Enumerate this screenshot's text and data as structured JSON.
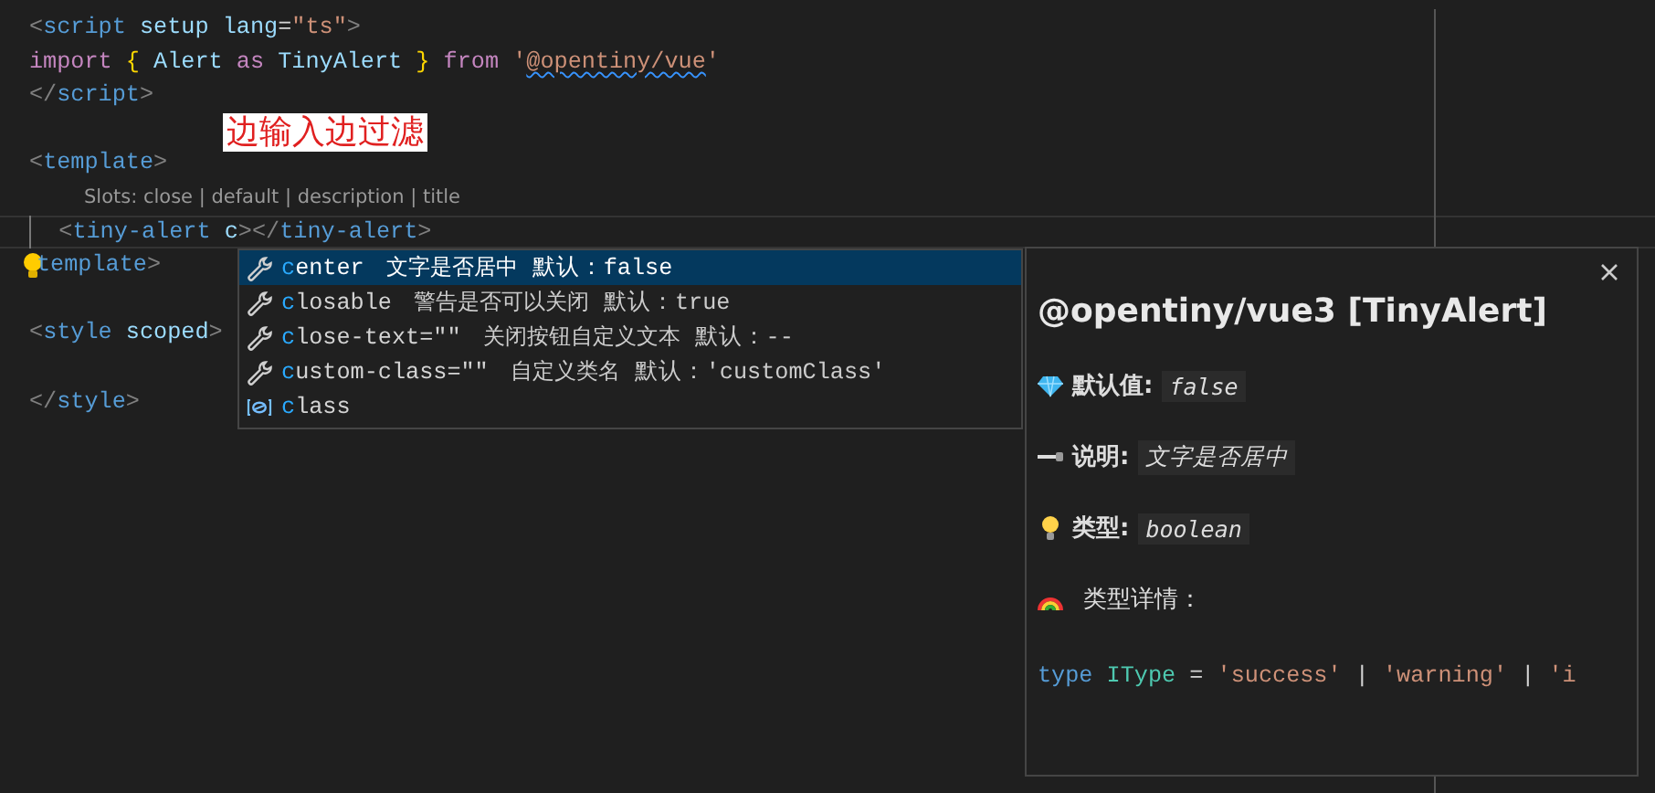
{
  "editor": {
    "lines": [
      {
        "kind": "code",
        "current": false,
        "lightbulb": false,
        "tokens": [
          {
            "text": "<",
            "kind": "bracket"
          },
          {
            "text": "script",
            "kind": "tag"
          },
          {
            "text": " setup",
            "kind": "attr"
          },
          {
            "text": " lang",
            "kind": "attr"
          },
          {
            "text": "=",
            "kind": "plain"
          },
          {
            "text": "\"ts\"",
            "kind": "string"
          },
          {
            "text": ">",
            "kind": "bracket"
          }
        ]
      },
      {
        "kind": "code",
        "current": false,
        "lightbulb": false,
        "tokens": [
          {
            "text": "import",
            "kind": "keyword"
          },
          {
            "text": " {",
            "kind": "brace"
          },
          {
            "text": " Alert",
            "kind": "variable"
          },
          {
            "text": " as",
            "kind": "keyword"
          },
          {
            "text": " TinyAlert",
            "kind": "variable"
          },
          {
            "text": " }",
            "kind": "brace"
          },
          {
            "text": " from",
            "kind": "keyword"
          },
          {
            "text": " '",
            "kind": "string"
          },
          {
            "text": "@opentiny/vue",
            "kind": "string",
            "squiggly": true
          },
          {
            "text": "'",
            "kind": "string"
          }
        ]
      },
      {
        "kind": "code",
        "current": false,
        "lightbulb": false,
        "tokens": [
          {
            "text": "</",
            "kind": "bracket"
          },
          {
            "text": "script",
            "kind": "tag"
          },
          {
            "text": ">",
            "kind": "bracket"
          }
        ]
      },
      {
        "kind": "blank"
      },
      {
        "kind": "code",
        "current": false,
        "lightbulb": false,
        "tokens": [
          {
            "text": "<",
            "kind": "bracket"
          },
          {
            "text": "template",
            "kind": "tag"
          },
          {
            "text": ">",
            "kind": "bracket"
          }
        ]
      },
      {
        "kind": "codelens",
        "text": "Slots: close | default | description | title"
      },
      {
        "kind": "code",
        "current": true,
        "lightbulb": false,
        "tokens": [
          {
            "text": "  <",
            "kind": "bracket"
          },
          {
            "text": "tiny-alert",
            "kind": "tag"
          },
          {
            "text": " c",
            "kind": "attr"
          },
          {
            "text": "></",
            "kind": "bracket"
          },
          {
            "text": "tiny-alert",
            "kind": "tag"
          },
          {
            "text": ">",
            "kind": "bracket"
          }
        ]
      },
      {
        "kind": "code",
        "current": false,
        "lightbulb": true,
        "tokens": [
          {
            "text": "template",
            "kind": "tag"
          },
          {
            "text": ">",
            "kind": "bracket"
          }
        ]
      },
      {
        "kind": "blank"
      },
      {
        "kind": "code",
        "current": false,
        "lightbulb": false,
        "tokens": [
          {
            "text": "<",
            "kind": "bracket"
          },
          {
            "text": "style",
            "kind": "tag"
          },
          {
            "text": " scoped",
            "kind": "attr"
          },
          {
            "text": ">",
            "kind": "bracket"
          }
        ]
      },
      {
        "kind": "blank"
      },
      {
        "kind": "code",
        "current": false,
        "lightbulb": false,
        "tokens": [
          {
            "text": "</",
            "kind": "bracket"
          },
          {
            "text": "style",
            "kind": "tag"
          },
          {
            "text": ">",
            "kind": "bracket"
          }
        ]
      }
    ]
  },
  "annotation": "边输入边过滤",
  "suggestions": [
    {
      "kind": "property",
      "label": "**c**enter",
      "detail": "文字是否居中",
      "default": "默认：false",
      "selected": true
    },
    {
      "kind": "property",
      "label": "**c**losable",
      "detail": "警告是否可以关闭",
      "default": "默认：true",
      "selected": false
    },
    {
      "kind": "property",
      "label": "**c**lose-text=\"\"",
      "detail": "关闭按钮自定义文本",
      "default": "默认：--",
      "selected": false
    },
    {
      "kind": "property",
      "label": "**c**ustom-class=\"\"",
      "detail": "自定义类名",
      "default": "默认：'customClass'",
      "selected": false
    },
    {
      "kind": "field",
      "label": "**c**lass",
      "selected": false
    }
  ],
  "hover": {
    "title": "@opentiny/vue3 [TinyAlert]",
    "rows": [
      {
        "kind": "default",
        "label": "默认值:",
        "value": "false"
      },
      {
        "kind": "description",
        "label": "说明:",
        "value": "文字是否居中"
      },
      {
        "kind": "type",
        "label": "类型:",
        "value": "boolean"
      }
    ],
    "details_heading": "类型详情：",
    "code": [
      {
        "text": "type",
        "kind": "keyword"
      },
      {
        "text": " IType",
        "kind": "type"
      },
      {
        "text": " = ",
        "kind": "plain"
      },
      {
        "text": "'success'",
        "kind": "string"
      },
      {
        "text": " | ",
        "kind": "plain"
      },
      {
        "text": "'warning'",
        "kind": "string"
      },
      {
        "text": " | ",
        "kind": "plain"
      },
      {
        "text": "'i",
        "kind": "string"
      }
    ]
  }
}
